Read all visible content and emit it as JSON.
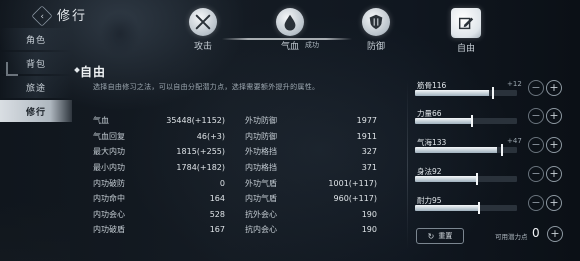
{
  "header": {
    "back_glyph": "‹",
    "title": "修行"
  },
  "tabs": [
    {
      "label": "攻击",
      "icon": "crossed-swords-icon"
    },
    {
      "label": "气血",
      "icon": "water-drop-icon",
      "sub": "成功"
    },
    {
      "label": "防御",
      "icon": "shield-icon"
    },
    {
      "label": "自由",
      "icon": "edit-icon",
      "active": true
    }
  ],
  "sidebar": {
    "items": [
      {
        "label": "角色"
      },
      {
        "label": "背包"
      },
      {
        "label": "旅途"
      },
      {
        "label": "修行",
        "active": true
      }
    ]
  },
  "main": {
    "title": "自由",
    "desc": "选择自由修习之法，可以自由分配潜力点，选择需要额外提升的属性。",
    "stats_left": [
      {
        "name": "气血",
        "value": "35448(+1152)"
      },
      {
        "name": "气血回复",
        "value": "46(+3)"
      },
      {
        "name": "最大内功",
        "value": "1815(+255)"
      },
      {
        "name": "最小内功",
        "value": "1784(+182)"
      },
      {
        "name": "内功破防",
        "value": "0"
      },
      {
        "name": "内功命中",
        "value": "164"
      },
      {
        "name": "内功会心",
        "value": "528"
      },
      {
        "name": "内功破盾",
        "value": "167"
      }
    ],
    "stats_right": [
      {
        "name": "外功防御",
        "value": "1977"
      },
      {
        "name": "内功防御",
        "value": "1911"
      },
      {
        "name": "外功格挡",
        "value": "327"
      },
      {
        "name": "内功格挡",
        "value": "371"
      },
      {
        "name": "外功气盾",
        "value": "1001(+117)"
      },
      {
        "name": "内功气盾",
        "value": "960(+117)"
      },
      {
        "name": "抗外会心",
        "value": "190"
      },
      {
        "name": "抗内会心",
        "value": "190"
      }
    ]
  },
  "attributes": [
    {
      "label": "筋骨116",
      "bonus": "+12",
      "fill": 0.73,
      "tick": 0.75
    },
    {
      "label": "力量66",
      "bonus": "",
      "fill": 0.55,
      "tick": 0.55
    },
    {
      "label": "气海133",
      "bonus": "+47",
      "fill": 0.8,
      "tick": 0.84
    },
    {
      "label": "身法92",
      "bonus": "",
      "fill": 0.6,
      "tick": 0.6
    },
    {
      "label": "耐力95",
      "bonus": "",
      "fill": 0.62,
      "tick": 0.62
    }
  ],
  "controls": {
    "reset_label": "重置",
    "points_label": "可用潜力点",
    "points_value": "0",
    "minus_glyph": "−",
    "plus_glyph": "+"
  }
}
